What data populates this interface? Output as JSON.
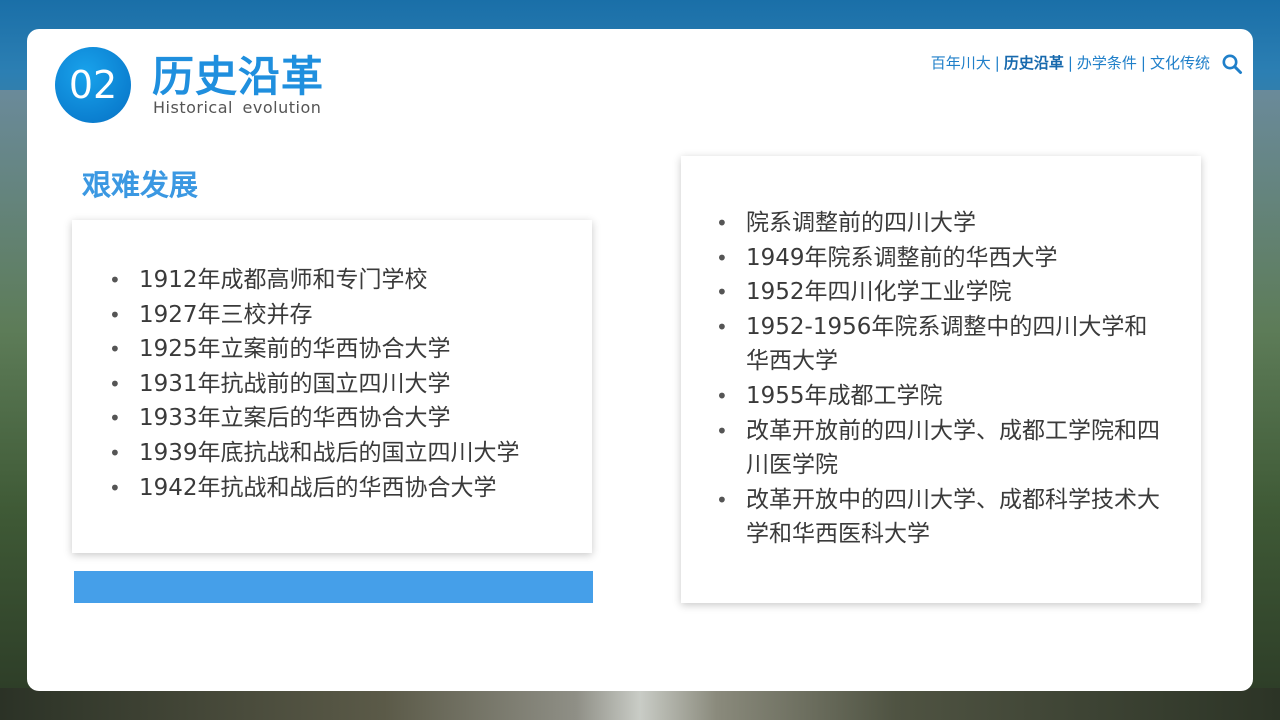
{
  "header": {
    "number": "02",
    "title": "历史沿革",
    "subtitle": "Historical  evolution"
  },
  "nav": {
    "items": [
      {
        "label": "百年川大"
      },
      {
        "label": "历史沿革",
        "active": true
      },
      {
        "label": "办学条件"
      },
      {
        "label": "文化传统"
      }
    ],
    "separator": "|",
    "search_icon": "search-icon"
  },
  "section": {
    "heading": "艰难发展"
  },
  "left_list": [
    "1912年成都高师和专门学校",
    "1927年三校并存",
    "1925年立案前的华西协合大学",
    "1931年抗战前的国立四川大学",
    "1933年立案后的华西协合大学",
    "1939年底抗战和战后的国立四川大学",
    "1942年抗战和战后的华西协合大学"
  ],
  "right_list": [
    "院系调整前的四川大学",
    "1949年院系调整前的华西大学",
    "1952年四川化学工业学院",
    "1952-1956年院系调整中的四川大学和华西大学",
    "1955年成都工学院",
    "改革开放前的四川大学、成都工学院和四川医学院",
    "改革开放中的四川大学、成都科学技术大学和华西医科大学"
  ],
  "colors": {
    "accent": "#1f8fde",
    "heading": "#3b98e2",
    "bar": "#459fe9"
  }
}
